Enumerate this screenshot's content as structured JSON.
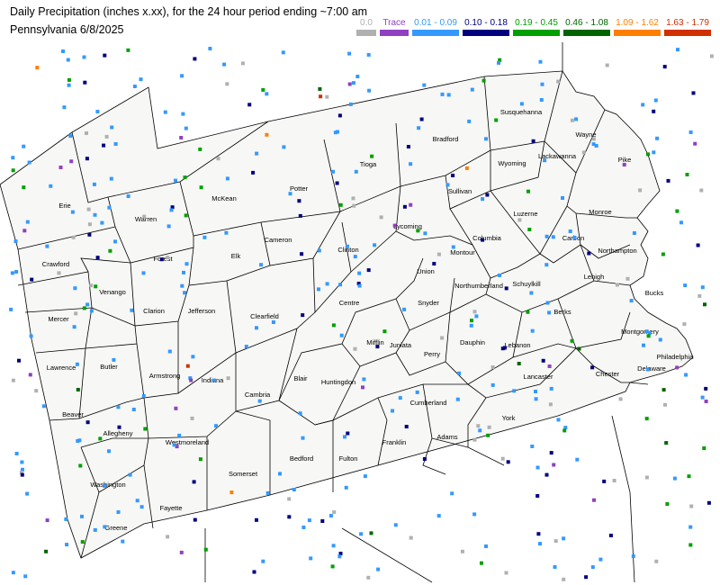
{
  "header": {
    "title": "Daily Precipitation (inches  x.xx),  for the 24 hour period ending ~7:00 am",
    "subtitle": "Pennsylvania 6/8/2025"
  },
  "legend": [
    {
      "label": "0.0",
      "color": "#b0b0b0"
    },
    {
      "label": "Trace",
      "color": "#9040c0"
    },
    {
      "label": "0.01 - 0.09",
      "color": "#3399ff"
    },
    {
      "label": "0.10 - 0.18",
      "color": "#00007f"
    },
    {
      "label": "0.19 - 0.45",
      "color": "#00a000"
    },
    {
      "label": "0.46 - 1.08",
      "color": "#006400"
    },
    {
      "label": "1.09 - 1.62",
      "color": "#ff7f00"
    },
    {
      "label": "1.63 - 1.79",
      "color": "#d03000"
    }
  ],
  "counties": [
    "Erie",
    "Warren",
    "McKean",
    "Potter",
    "Tioga",
    "Bradford",
    "Susquehanna",
    "Wayne",
    "Wyoming",
    "Lackawanna",
    "Pike",
    "Sullivan",
    "Lycoming",
    "Clinton",
    "Cameron",
    "Elk",
    "Forest",
    "Crawford",
    "Venango",
    "Mercer",
    "Lawrence",
    "Butler",
    "Clarion",
    "Jefferson",
    "Clearfield",
    "Centre",
    "Union",
    "Snyder",
    "Montour",
    "Columbia",
    "Luzerne",
    "Monroe",
    "Carbon",
    "Northampton",
    "Lehigh",
    "Schuylkill",
    "Northumberland",
    "Bucks",
    "Berks",
    "Montgomery",
    "Philadelphia",
    "Delaware",
    "Chester",
    "Lancaster",
    "Lebanon",
    "Dauphin",
    "Perry",
    "Juniata",
    "Mifflin",
    "Huntingdon",
    "Blair",
    "Cambria",
    "Indiana",
    "Armstrong",
    "Beaver",
    "Allegheny",
    "Westmoreland",
    "Washington",
    "Greene",
    "Fayette",
    "Somerset",
    "Bedford",
    "Fulton",
    "Franklin",
    "Cumberland",
    "Adams",
    "York"
  ]
}
